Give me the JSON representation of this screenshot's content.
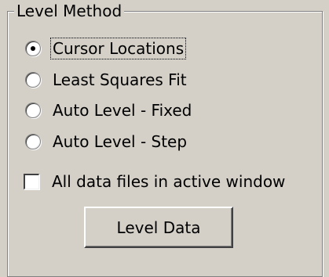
{
  "group": {
    "title": "Level Method"
  },
  "options": [
    {
      "label": "Cursor Locations",
      "selected": true
    },
    {
      "label": "Least Squares Fit",
      "selected": false
    },
    {
      "label": "Auto Level - Fixed",
      "selected": false
    },
    {
      "label": "Auto Level - Step",
      "selected": false
    }
  ],
  "checkbox": {
    "label": "All data files in active window",
    "checked": false
  },
  "button": {
    "label": "Level Data"
  }
}
